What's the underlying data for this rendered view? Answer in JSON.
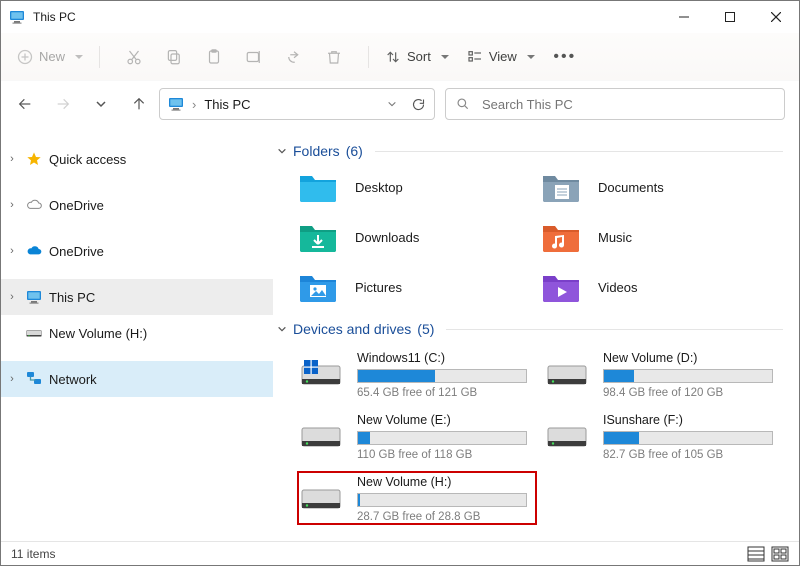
{
  "window": {
    "title": "This PC"
  },
  "toolbar": {
    "new_label": "New",
    "sort_label": "Sort",
    "view_label": "View"
  },
  "address": {
    "location": "This PC"
  },
  "search": {
    "placeholder": "Search This PC"
  },
  "sidebar": {
    "items": [
      {
        "label": "Quick access"
      },
      {
        "label": "OneDrive"
      },
      {
        "label": "OneDrive"
      },
      {
        "label": "This PC"
      },
      {
        "label": "New Volume (H:)"
      },
      {
        "label": "Network"
      }
    ]
  },
  "sections": {
    "folders": {
      "title": "Folders",
      "count": "(6)"
    },
    "drives": {
      "title": "Devices and drives",
      "count": "(5)"
    }
  },
  "folders": [
    {
      "label": "Desktop"
    },
    {
      "label": "Documents"
    },
    {
      "label": "Downloads"
    },
    {
      "label": "Music"
    },
    {
      "label": "Pictures"
    },
    {
      "label": "Videos"
    }
  ],
  "drives": [
    {
      "label": "Windows11 (C:)",
      "free": "65.4 GB free of 121 GB",
      "fill_pct": 46
    },
    {
      "label": "New Volume (D:)",
      "free": "98.4 GB free of 120 GB",
      "fill_pct": 18
    },
    {
      "label": "New Volume (E:)",
      "free": "110 GB free of 118 GB",
      "fill_pct": 7
    },
    {
      "label": "ISunshare (F:)",
      "free": "82.7 GB free of 105 GB",
      "fill_pct": 21
    },
    {
      "label": "New Volume (H:)",
      "free": "28.7 GB free of 28.8 GB",
      "fill_pct": 1
    }
  ],
  "status": {
    "count_text": "11 items"
  }
}
